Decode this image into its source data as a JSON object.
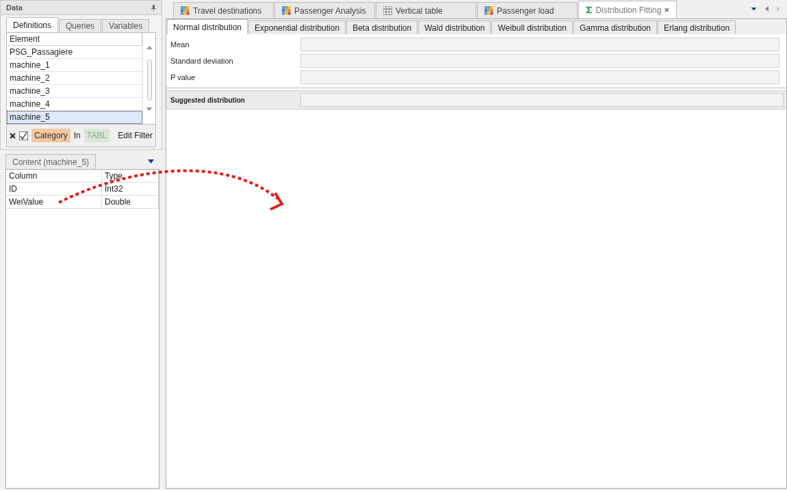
{
  "data_panel": {
    "title": "Data",
    "tabs": [
      {
        "label": "Definitions",
        "selected": true
      },
      {
        "label": "Queries",
        "selected": false
      },
      {
        "label": "Variables",
        "selected": false
      }
    ],
    "element_list": {
      "column": "Element",
      "items": [
        {
          "label": "PSG_Passagiere",
          "selected": false
        },
        {
          "label": "machine_1",
          "selected": false
        },
        {
          "label": "machine_2",
          "selected": false
        },
        {
          "label": "machine_3",
          "selected": false
        },
        {
          "label": "machine_4",
          "selected": false
        },
        {
          "label": "machine_5",
          "selected": true
        }
      ]
    },
    "filter": {
      "checked": true,
      "field": "Category",
      "operator": "In",
      "value": "TABL",
      "edit": "Edit Filter"
    },
    "content_tab": "Content (machine_5)",
    "content_table": {
      "columns": [
        "Column",
        "Type"
      ],
      "rows": [
        [
          "ID",
          "Int32"
        ],
        [
          "WeiValue",
          "Double"
        ]
      ]
    }
  },
  "document_tabs": [
    {
      "label": "Travel destinations",
      "kind": "color-grid",
      "selected": false,
      "closable": false
    },
    {
      "label": "Passenger Analysis",
      "kind": "color-grid",
      "selected": false,
      "closable": false
    },
    {
      "label": "Vertical table",
      "kind": "plain-grid",
      "selected": false,
      "closable": false
    },
    {
      "label": "Passenger load",
      "kind": "color-grid",
      "selected": false,
      "closable": false
    },
    {
      "label": "Distribution Fitting",
      "kind": "sigma",
      "selected": true,
      "closable": true
    }
  ],
  "distribution_tabs": [
    {
      "label": "Normal distribution",
      "selected": true
    },
    {
      "label": "Exponential distribution",
      "selected": false
    },
    {
      "label": "Beta distribution",
      "selected": false
    },
    {
      "label": "Wald distribution",
      "selected": false
    },
    {
      "label": "Weibull distribution",
      "selected": false
    },
    {
      "label": "Gamma distribution",
      "selected": false
    },
    {
      "label": "Erlang distribution",
      "selected": false
    }
  ],
  "fields": [
    {
      "label": "Mean"
    },
    {
      "label": "Standard deviation"
    },
    {
      "label": "P value"
    }
  ],
  "suggested": {
    "label": "Suggested distribution"
  }
}
